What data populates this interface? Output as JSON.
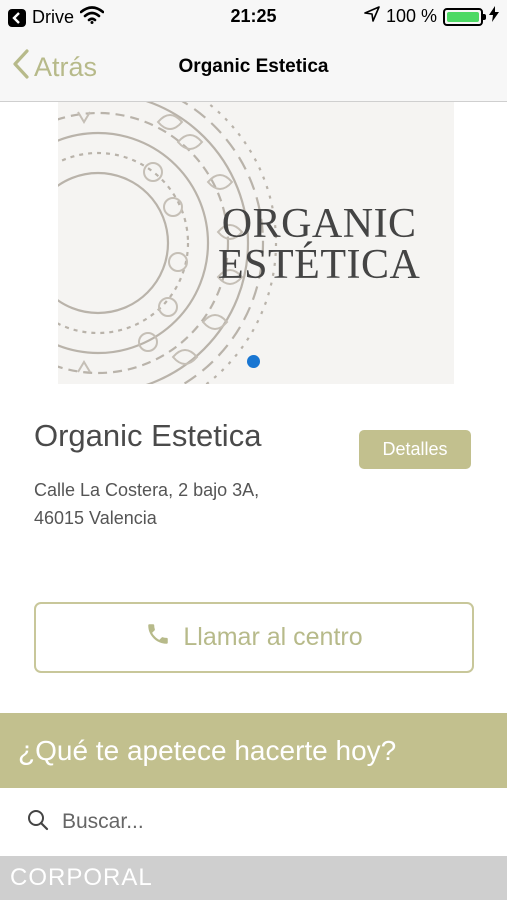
{
  "status_bar": {
    "carrier": "Drive",
    "time": "21:25",
    "battery": "100 %",
    "battery_level": 1.0,
    "battery_color": "#4cd964"
  },
  "nav": {
    "back_label": "Atrás",
    "title": "Organic Estetica"
  },
  "hero": {
    "brand_line1": "ORGANIC",
    "brand_line2": "ESTÉTICA",
    "active_dot_color": "#1976d2"
  },
  "center": {
    "name": "Organic Estetica",
    "details_label": "Detalles",
    "address_line1": "Calle La Costera, 2 bajo 3A,",
    "address_line2": "46015 Valencia",
    "call_label": "Llamar al centro"
  },
  "question": {
    "text": "¿Qué te apetece hacerte hoy?"
  },
  "search": {
    "placeholder": "Buscar..."
  },
  "category": {
    "label": "CORPORAL"
  },
  "colors": {
    "accent": "#c2c08e",
    "accent_text": "#b7ba8a"
  },
  "icons": [
    "back-app-icon",
    "wifi-icon",
    "location-arrow-icon",
    "battery-icon",
    "charging-bolt-icon",
    "chevron-left-icon",
    "phone-icon",
    "search-icon"
  ]
}
